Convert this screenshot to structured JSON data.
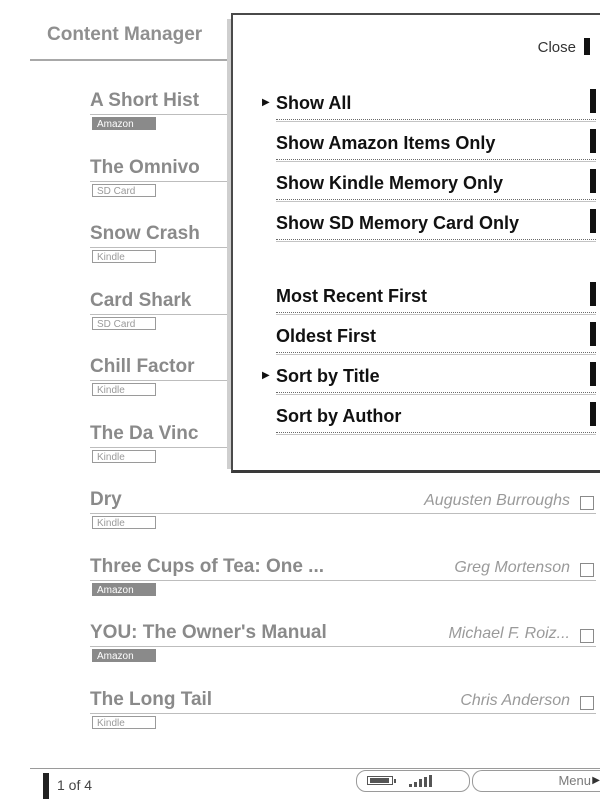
{
  "header": {
    "title": "Content Manager"
  },
  "items": [
    {
      "title": "A Short Hist",
      "author": "",
      "source": "Amazon",
      "badge_style": "filled"
    },
    {
      "title": "The Omnivo",
      "author": "",
      "source": "SD Card",
      "badge_style": "outline"
    },
    {
      "title": "Snow Crash",
      "author": "",
      "source": "Kindle",
      "badge_style": "outline"
    },
    {
      "title": "Card Shark",
      "author": "",
      "source": "SD Card",
      "badge_style": "outline"
    },
    {
      "title": "Chill Factor",
      "author": "",
      "source": "Kindle",
      "badge_style": "outline"
    },
    {
      "title": "The Da Vinc",
      "author": "",
      "source": "Kindle",
      "badge_style": "outline"
    },
    {
      "title": "Dry",
      "author": "Augusten Burroughs",
      "source": "Kindle",
      "badge_style": "outline"
    },
    {
      "title": "Three Cups of Tea: One ...",
      "author": "Greg Mortenson",
      "source": "Amazon",
      "badge_style": "filled"
    },
    {
      "title": "YOU: The Owner's Manual",
      "author": "Michael F. Roiz...",
      "source": "Amazon",
      "badge_style": "filled"
    },
    {
      "title": "The Long Tail",
      "author": "Chris Anderson",
      "source": "Kindle",
      "badge_style": "outline"
    }
  ],
  "menu": {
    "close_label": "Close",
    "filter_options": [
      {
        "label": "Show All",
        "selected": true
      },
      {
        "label": "Show Amazon Items Only",
        "selected": false
      },
      {
        "label": "Show Kindle Memory Only",
        "selected": false
      },
      {
        "label": "Show SD Memory Card Only",
        "selected": false
      }
    ],
    "sort_options": [
      {
        "label": "Most Recent First",
        "selected": false
      },
      {
        "label": "Oldest First",
        "selected": false
      },
      {
        "label": "Sort by Title",
        "selected": true
      },
      {
        "label": "Sort by Author",
        "selected": false
      }
    ]
  },
  "footer": {
    "page_indicator": "1 of 4",
    "menu_label": "Menu"
  },
  "icons": {
    "battery": "battery-icon",
    "signal": "signal-strength-icon",
    "selected_marker": "right-triangle-icon",
    "menu_arrow": "right-triangle-icon"
  },
  "colors": {
    "text_dim": "#8a8a8a",
    "text_dark": "#111111",
    "badge_fill": "#8a8a8a",
    "panel_border": "#4a4a4a"
  }
}
